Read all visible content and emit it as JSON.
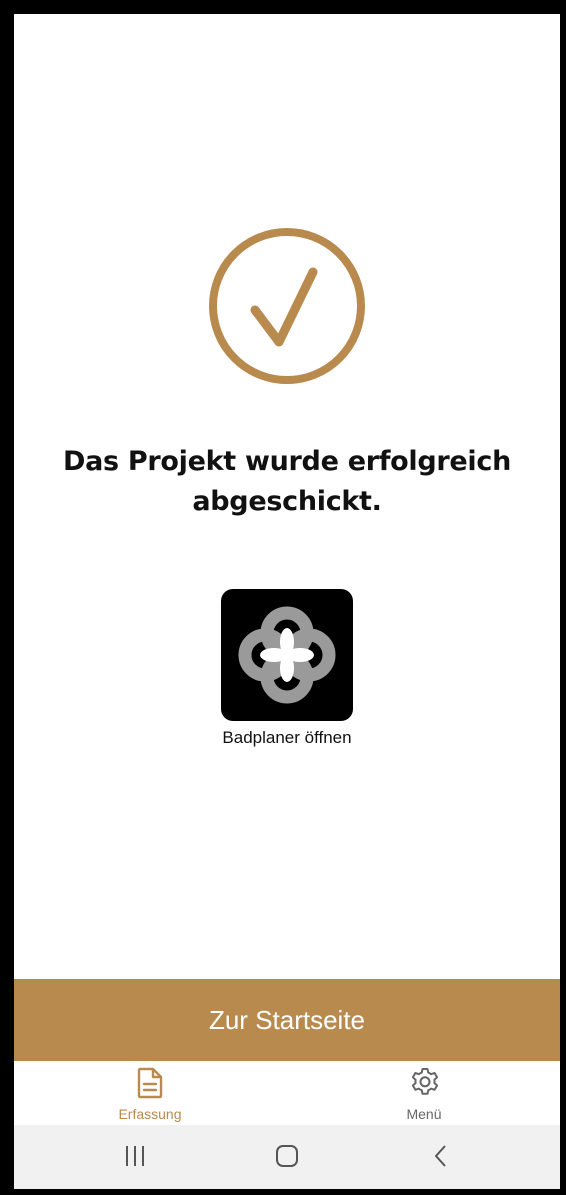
{
  "colors": {
    "accent": "#b98a4e",
    "tab_inactive": "#666666",
    "background": "#ffffff",
    "system_nav_bg": "#f1f1f1"
  },
  "success": {
    "icon": "check-circle-icon",
    "message_line1": "Das Projekt wurde erfolgreich",
    "message_line2": "abgeschickt."
  },
  "app_link": {
    "icon": "badplaner-app-icon",
    "label": "Badplaner öffnen"
  },
  "cta": {
    "label": "Zur Startseite"
  },
  "tabbar": {
    "items": [
      {
        "label": "Erfassung",
        "icon": "document-icon",
        "active": true
      },
      {
        "label": "Menü",
        "icon": "gear-icon",
        "active": false
      }
    ]
  },
  "system_nav": {
    "buttons": [
      "recent-apps-icon",
      "home-icon",
      "back-icon"
    ]
  }
}
